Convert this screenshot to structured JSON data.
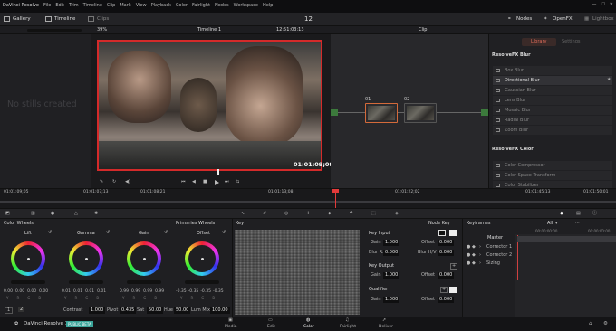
{
  "menu": [
    "DaVinci Resolve",
    "File",
    "Edit",
    "Trim",
    "Timeline",
    "Clip",
    "Mark",
    "View",
    "Playback",
    "Color",
    "Fairlight",
    "Nodes",
    "Workspace",
    "Help"
  ],
  "topbar": {
    "gallery": "Gallery",
    "timeline": "Timeline",
    "clips": "Clips",
    "clip_number": "12",
    "nodes": "Nodes",
    "openfx": "OpenFX",
    "lightbox": "Lightbox"
  },
  "viewerbar": {
    "zoom": "39%",
    "timeline_name": "Timeline 1",
    "timecode": "12:51:03:13",
    "clip_mode": "Clip"
  },
  "gallery": {
    "empty_text": "No stills created"
  },
  "viewer": {
    "timecode": "01:01:09;09"
  },
  "nodes": {
    "node1": "01",
    "node2": "02"
  },
  "fx": {
    "tab_library": "Library",
    "tab_settings": "Settings",
    "section_blur": "ResolveFX Blur",
    "blur_items": [
      "Box Blur",
      "Directional Blur",
      "Gaussian Blur",
      "Lens Blur",
      "Mosaic Blur",
      "Radial Blur",
      "Zoom Blur"
    ],
    "section_color": "ResolveFX Color",
    "color_items": [
      "Color Compressor",
      "Color Space Transform",
      "Color Stabilizer"
    ]
  },
  "timeline_ticks": [
    "01:01:09;05",
    "01:01:07;13",
    "01:01:08;21",
    "01:01:13;08",
    "01:01:22;02",
    "01:01:45;13",
    "01:01:50;01"
  ],
  "wheels": {
    "title": "Color Wheels",
    "primaries": "Primaries Wheels",
    "items": [
      {
        "name": "Lift",
        "values": [
          "0.00",
          "0.00",
          "0.00",
          "0.00"
        ]
      },
      {
        "name": "Gamma",
        "values": [
          "0.01",
          "0.01",
          "0.01",
          "0.01"
        ]
      },
      {
        "name": "Gain",
        "values": [
          "0.99",
          "0.99",
          "0.99",
          "0.99"
        ]
      },
      {
        "name": "Offset",
        "values": [
          "-0.35",
          "-0.35",
          "-0.35",
          "-0.35"
        ]
      }
    ],
    "channel_labels": [
      "Y",
      "R",
      "G",
      "B"
    ],
    "page1": "1",
    "page2": "2",
    "contrast_label": "Contrast",
    "contrast": "1.000",
    "pivot_label": "Pivot",
    "pivot": "0.435",
    "sat_label": "Sat",
    "sat": "50.00",
    "hue_label": "Hue",
    "hue": "50.00",
    "lummix_label": "Lum Mix",
    "lummix": "100.00"
  },
  "key": {
    "title": "Key",
    "node_key": "Node Key",
    "key_input": "Key Input",
    "gain_label": "Gain",
    "gain": "1.000",
    "offset_label": "Offset",
    "offset": "0.000",
    "blurr_label": "Blur R.",
    "blurr": "0.000",
    "blurhv_label": "Blur H/V",
    "blurhv": "0.000",
    "key_output": "Key Output",
    "out_gain": "1.000",
    "out_offset": "0.000",
    "qualifier": "Qualifier",
    "q_gain": "1.000",
    "q_offset": "0.000"
  },
  "keyframes": {
    "title": "Keyframes",
    "filter": "All",
    "start_tc": "00:00:00:00",
    "end_tc": "00:00:00:00",
    "master": "Master",
    "rows": [
      "Corrector 1",
      "Corrector 2",
      "Sizing"
    ]
  },
  "bottom": {
    "app": "DaVinci Resolve 14",
    "beta": "PUBLIC BETA",
    "pages": [
      "Media",
      "Edit",
      "Color",
      "Fairlight",
      "Deliver"
    ],
    "active_page": "Color"
  },
  "colors": {
    "accent": "#e06b5a",
    "viewer_border": "#d42a2a",
    "playhead": "#e23a3a"
  }
}
